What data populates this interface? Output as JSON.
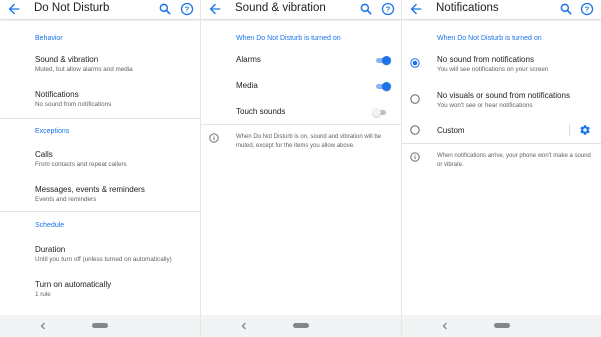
{
  "colors": {
    "accent": "#1a73e8",
    "text": "#202124",
    "secondary": "#5f6368",
    "navbar": "#f1f3f4"
  },
  "panel_dnd": {
    "title": "Do Not Disturb",
    "icons": [
      "back-arrow-icon",
      "search-icon",
      "help-icon"
    ],
    "sections": [
      {
        "header": "Behavior",
        "items": [
          {
            "title": "Sound & vibration",
            "subtitle": "Muted, but allow alarms and media"
          },
          {
            "title": "Notifications",
            "subtitle": "No sound from notifications"
          }
        ]
      },
      {
        "header": "Exceptions",
        "items": [
          {
            "title": "Calls",
            "subtitle": "From contacts and repeat callers"
          },
          {
            "title": "Messages, events & reminders",
            "subtitle": "Events and reminders"
          }
        ]
      },
      {
        "header": "Schedule",
        "items": [
          {
            "title": "Duration",
            "subtitle": "Until you turn off (unless turned on automatically)"
          },
          {
            "title": "Turn on automatically",
            "subtitle": "1 rule"
          }
        ]
      }
    ]
  },
  "panel_sound": {
    "title": "Sound & vibration",
    "icons": [
      "back-arrow-icon",
      "search-icon",
      "help-icon"
    ],
    "header": "When Do Not Disturb is turned on",
    "toggles": [
      {
        "label": "Alarms",
        "on": true
      },
      {
        "label": "Media",
        "on": true
      },
      {
        "label": "Touch sounds",
        "on": false
      }
    ],
    "info": "When Do Not Disturb is on, sound and vibration will be muted, except for the items you allow above."
  },
  "panel_notif": {
    "title": "Notifications",
    "icons": [
      "back-arrow-icon",
      "search-icon",
      "help-icon"
    ],
    "header": "When Do Not Disturb is turned on",
    "options": [
      {
        "title": "No sound from notifications",
        "subtitle": "You will see notifications on your screen",
        "selected": true
      },
      {
        "title": "No visuals or sound from notifications",
        "subtitle": "You won't see or hear notifications",
        "selected": false
      },
      {
        "title": "Custom",
        "subtitle": "",
        "selected": false
      }
    ],
    "custom_icon": "gear-icon",
    "info": "When notifications arrive, your phone won't make a sound or vibrate."
  },
  "nav_icons": [
    "nav-back-icon",
    "nav-home-pill-icon"
  ]
}
